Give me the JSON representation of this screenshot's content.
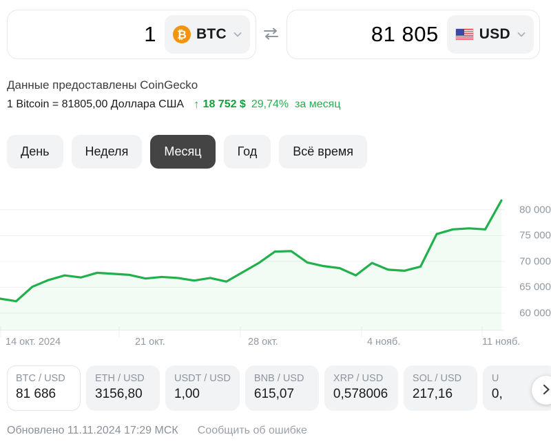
{
  "converter": {
    "from": {
      "amount": "1",
      "currency_code": "BTC",
      "icon": "bitcoin-coin-icon",
      "glyph": "₿",
      "chevron": "chevron-down-icon"
    },
    "swap_icon": "swap-arrows-icon",
    "to": {
      "amount": "81 805",
      "currency_code": "USD",
      "icon": "us-flag-icon",
      "chevron": "chevron-down-icon"
    }
  },
  "info": {
    "source_text": "Данные предоставлены CoinGecko",
    "rate_text": "1 Bitcoin = 81805,00 Доллара США",
    "arrow": "↑",
    "delta_absolute": "18 752 $",
    "delta_percent": "29,74%",
    "delta_period": "за месяц"
  },
  "periods": [
    {
      "label": "День",
      "active": false
    },
    {
      "label": "Неделя",
      "active": false
    },
    {
      "label": "Месяц",
      "active": true
    },
    {
      "label": "Год",
      "active": false
    },
    {
      "label": "Всё время",
      "active": false
    }
  ],
  "chart_data": {
    "type": "line",
    "title": "",
    "xlabel": "",
    "ylabel": "",
    "ylim": [
      58000,
      82500
    ],
    "yticks": [
      60000,
      65000,
      70000,
      75000,
      80000
    ],
    "ytick_labels": [
      "60 000",
      "65 000",
      "70 000",
      "75 000",
      "80 000"
    ],
    "xtick_labels": [
      "14 окт. 2024",
      "21 окт.",
      "28 окт.",
      "4 нояб.",
      "11 нояб."
    ],
    "grid": true,
    "legend": "none",
    "line_color": "#21b14c",
    "area_fill_color": "#21b14c",
    "series": [
      {
        "name": "BTC / USD",
        "x": [
          "14 окт. 2024",
          "15 окт.",
          "16 окт.",
          "17 окт.",
          "18 окт.",
          "19 окт.",
          "20 окт.",
          "21 окт.",
          "22 окт.",
          "23 окт.",
          "24 окт.",
          "25 окт.",
          "26 окт.",
          "27 окт.",
          "28 окт.",
          "29 окт.",
          "30 окт.",
          "31 окт.",
          "1 нояб.",
          "2 нояб.",
          "3 нояб.",
          "4 нояб.",
          "5 нояб.",
          "6 нояб.",
          "7 нояб.",
          "8 нояб.",
          "9 нояб.",
          "10 нояб.",
          "11 нояб."
        ],
        "values": [
          62800,
          62300,
          65100,
          66400,
          67300,
          66900,
          67800,
          67600,
          67400,
          66700,
          67000,
          66800,
          66300,
          66800,
          66100,
          67900,
          69700,
          71900,
          72000,
          69800,
          69100,
          68700,
          67300,
          69700,
          68400,
          68200,
          69000,
          75300,
          76200,
          76400,
          76200,
          81805
        ]
      }
    ]
  },
  "pairs": [
    {
      "name": "BTC / USD",
      "value": "81 686",
      "selected": true
    },
    {
      "name": "ETH / USD",
      "value": "3156,80",
      "selected": false
    },
    {
      "name": "USDT / USD",
      "value": "1,00",
      "selected": false
    },
    {
      "name": "BNB / USD",
      "value": "615,07",
      "selected": false
    },
    {
      "name": "XRP / USD",
      "value": "0,578006",
      "selected": false
    },
    {
      "name": "SOL / USD",
      "value": "217,16",
      "selected": false
    },
    {
      "name": "U",
      "value": "0,",
      "selected": false
    }
  ],
  "pairs_next_icon": "chevron-right-icon",
  "footer": {
    "updated": "Обновлено 11.11.2024 17:29 МСК",
    "report_error": "Сообщить об ошибке"
  }
}
